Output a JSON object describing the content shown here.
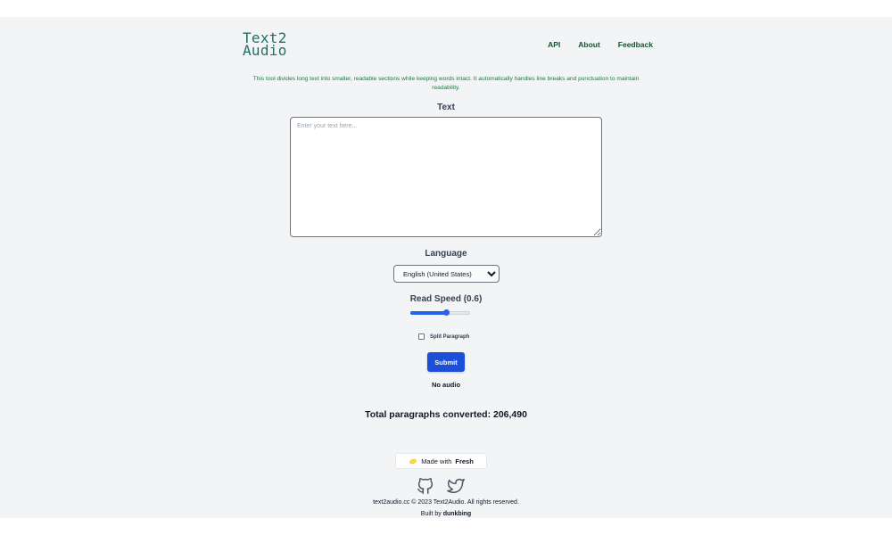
{
  "header": {
    "logo_line1": "Text2",
    "logo_line2": "Audio",
    "nav": [
      "API",
      "About",
      "Feedback"
    ]
  },
  "description": "This tool divides long text into smaller, readable sections while keeping words intact. It automatically handles line breaks and punctuation to maintain readability.",
  "text_section": {
    "label": "Text",
    "placeholder": "Enter your text here...",
    "value": ""
  },
  "language": {
    "label": "Language",
    "selected": "English (United States)"
  },
  "speed": {
    "label": "Read Speed (0.6)",
    "value": 0.6,
    "min": 0,
    "max": 1
  },
  "split": {
    "label": "Split Paragraph",
    "checked": false
  },
  "submit_label": "Submit",
  "audio_status": "No audio",
  "total_converted": "Total paragraphs converted: 206,490",
  "footer": {
    "made_with": "Made with",
    "made_with_brand": "Fresh",
    "copyright": "text2audio.cc © 2023 Text2Audio. All rights reserved.",
    "built_by_prefix": "Built by",
    "built_by_name": "dunkbing"
  },
  "icons": {
    "fresh": "lemon-icon",
    "github": "github-icon",
    "twitter": "twitter-icon"
  },
  "colors": {
    "accent": "#1d4ed8",
    "slider": "#2563eb",
    "logo": "#1f6f67",
    "description": "#15803d",
    "nav": "#14532d",
    "background": "#f2f4f6"
  }
}
